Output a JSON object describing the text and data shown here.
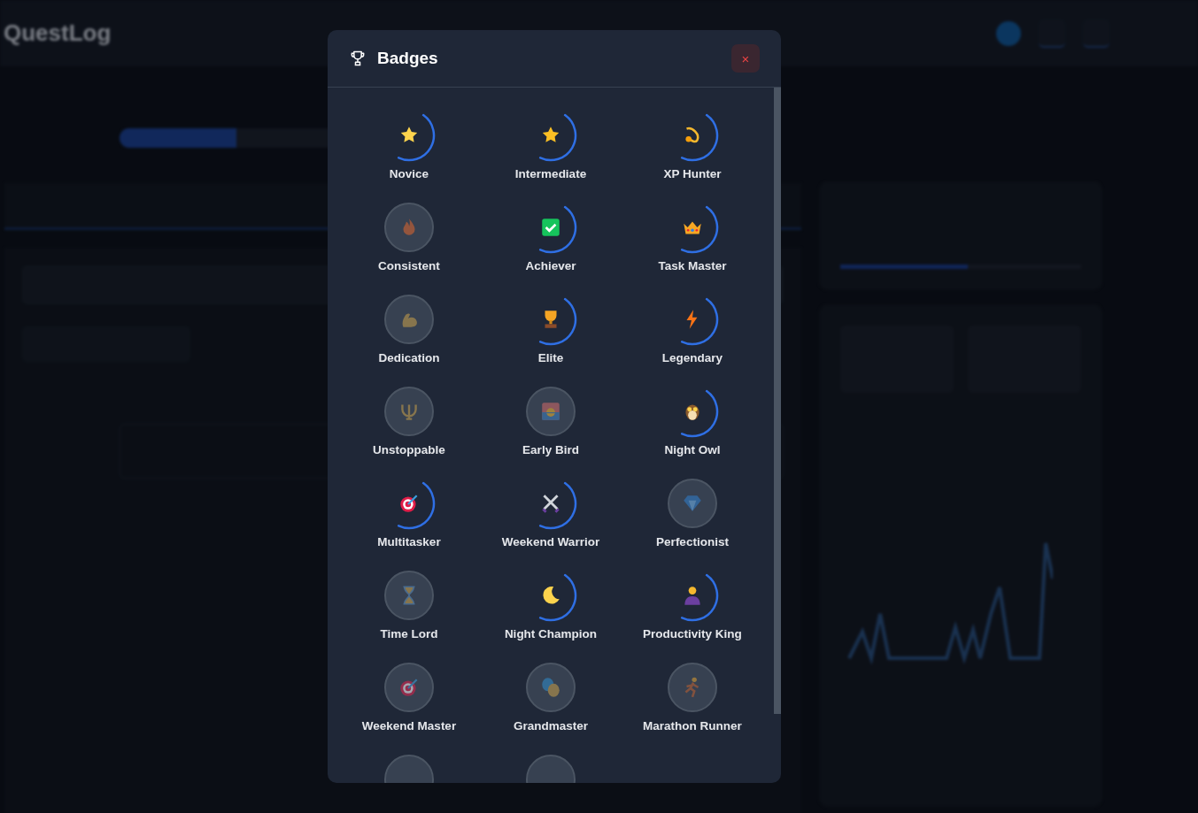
{
  "app": {
    "logo": "QuestLog"
  },
  "xp_progress": {
    "level": 0.33
  },
  "badge_progress": {
    "level": 0.53
  },
  "modal": {
    "title": "Badges",
    "close_label": "×"
  },
  "badges": [
    {
      "name": "Novice",
      "unlocked": true
    },
    {
      "name": "Intermediate",
      "unlocked": true
    },
    {
      "name": "XP Hunter",
      "unlocked": true
    },
    {
      "name": "Consistent",
      "unlocked": false
    },
    {
      "name": "Achiever",
      "unlocked": true
    },
    {
      "name": "Task Master",
      "unlocked": true
    },
    {
      "name": "Dedication",
      "unlocked": false
    },
    {
      "name": "Elite",
      "unlocked": true
    },
    {
      "name": "Legendary",
      "unlocked": true
    },
    {
      "name": "Unstoppable",
      "unlocked": false
    },
    {
      "name": "Early Bird",
      "unlocked": false
    },
    {
      "name": "Night Owl",
      "unlocked": true
    },
    {
      "name": "Multitasker",
      "unlocked": true
    },
    {
      "name": "Weekend Warrior",
      "unlocked": true
    },
    {
      "name": "Perfectionist",
      "unlocked": false
    },
    {
      "name": "Time Lord",
      "unlocked": false
    },
    {
      "name": "Night Champion",
      "unlocked": true
    },
    {
      "name": "Productivity King",
      "unlocked": true
    },
    {
      "name": "Weekend Master",
      "unlocked": false
    },
    {
      "name": "Grandmaster",
      "unlocked": false
    },
    {
      "name": "Marathon Runner",
      "unlocked": false
    },
    {
      "unlocked": false
    },
    {
      "unlocked": false
    }
  ]
}
